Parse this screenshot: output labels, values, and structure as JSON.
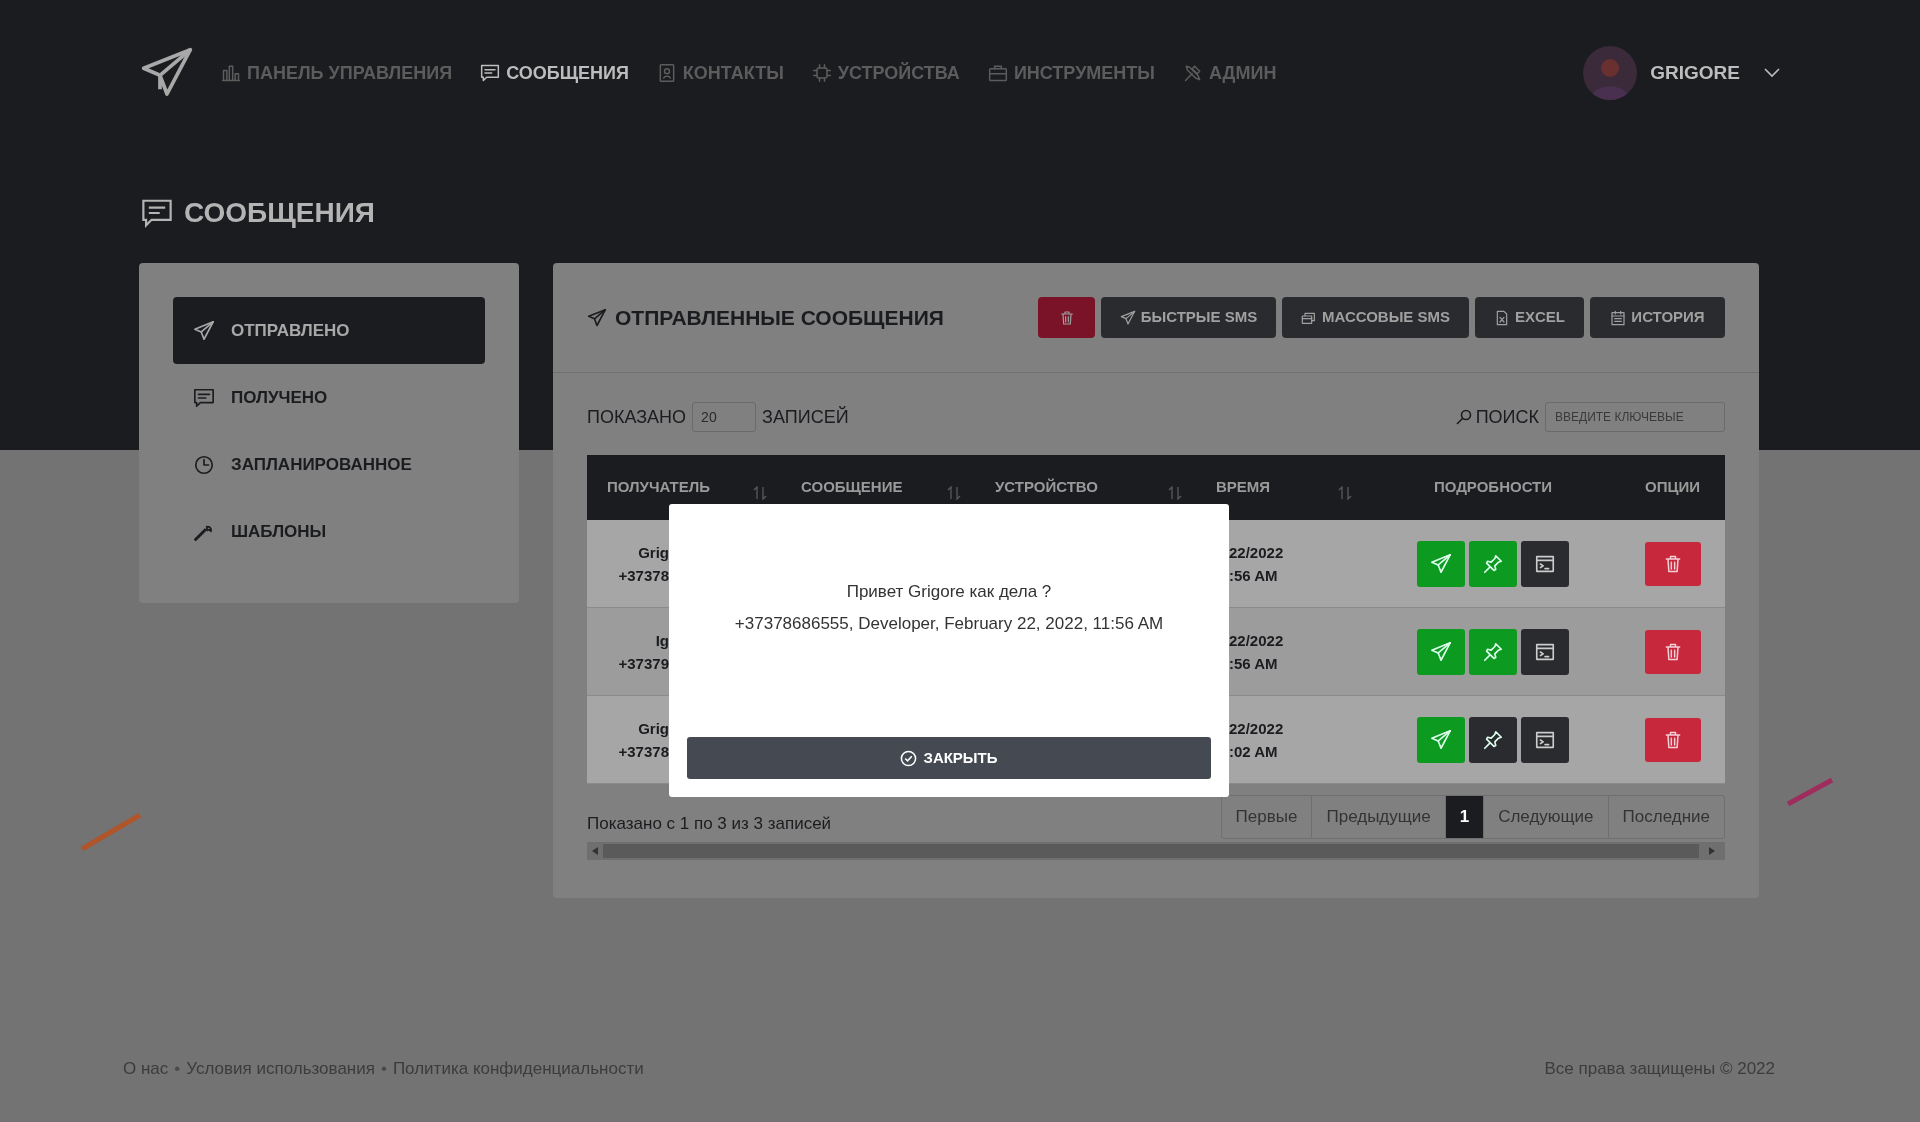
{
  "nav": {
    "items": [
      {
        "label": "ПАНЕЛЬ УПРАВЛЕНИЯ",
        "selected": false
      },
      {
        "label": "СООБЩЕНИЯ",
        "selected": true
      },
      {
        "label": "КОНТАКТЫ",
        "selected": false
      },
      {
        "label": "УСТРОЙСТВА",
        "selected": false
      },
      {
        "label": "ИНСТРУМЕНТЫ",
        "selected": false
      },
      {
        "label": "АДМИН",
        "selected": false
      }
    ],
    "user": {
      "name": "GRIGORE"
    }
  },
  "page_title": "СООБЩЕНИЯ",
  "sidebar": {
    "items": [
      {
        "label": "ОТПРАВЛЕНО",
        "selected": true
      },
      {
        "label": "ПОЛУЧЕНО",
        "selected": false
      },
      {
        "label": "ЗАПЛАНИРОВАННОЕ",
        "selected": false
      },
      {
        "label": "ШАБЛОНЫ",
        "selected": false
      }
    ]
  },
  "panel": {
    "title": "ОТПРАВЛЕННЫЕ СООБЩЕНИЯ",
    "buttons": [
      {
        "kind": "danger"
      },
      {
        "kind": "dark",
        "label": "БЫСТРЫЕ SMS"
      },
      {
        "kind": "dark",
        "label": "МАССОВЫЕ SMS"
      },
      {
        "kind": "dark",
        "label": "EXCEL"
      },
      {
        "kind": "dark",
        "label": "ИСТОРИЯ"
      }
    ]
  },
  "length_control": {
    "before": "ПОКАЗАНО",
    "value": "20",
    "after": "ЗАПИСЕЙ"
  },
  "search": {
    "label": "ПОИСК",
    "placeholder": "ВВЕДИТЕ КЛЮЧЕВЫЕ"
  },
  "table": {
    "columns": [
      {
        "label": "ПОЛУЧАТЕЛЬ",
        "sortable": true
      },
      {
        "label": "СООБЩЕНИЕ",
        "sortable": true
      },
      {
        "label": "УСТРОЙСТВО",
        "sortable": true
      },
      {
        "label": "ВРЕМЯ",
        "sortable": true
      },
      {
        "label": "ПОДРОБНОСТИ",
        "sortable": false
      },
      {
        "label": "ОПЦИИ",
        "sortable": false
      }
    ],
    "rows": [
      {
        "recipient": [
          "Grig",
          "+37378"
        ],
        "time": [
          "22/2022",
          ":56 AM"
        ],
        "pinned": true
      },
      {
        "recipient": [
          "Ig",
          "+37379"
        ],
        "time": [
          "22/2022",
          ":56 AM"
        ],
        "pinned": true
      },
      {
        "recipient": [
          "Grig",
          "+37378"
        ],
        "time": [
          "22/2022",
          ":02 AM"
        ],
        "pinned": false
      }
    ]
  },
  "info": "Показано с 1 по 3 из 3 записей",
  "pagination": [
    {
      "label": "Первые",
      "selected": false
    },
    {
      "label": "Предыдущие",
      "selected": false
    },
    {
      "label": "1",
      "selected": true
    },
    {
      "label": "Следующие",
      "selected": false
    },
    {
      "label": "Последние",
      "selected": false
    }
  ],
  "footer": {
    "links": [
      {
        "kind": "link",
        "text": "О нас"
      },
      {
        "kind": "separator",
        "text": "•"
      },
      {
        "kind": "link",
        "text": "Условия использования"
      },
      {
        "kind": "separator",
        "text": "•"
      },
      {
        "kind": "link",
        "text": "Политика конфиденциальности"
      }
    ],
    "copyright": "Все права защищены © 2022"
  },
  "modal": {
    "message": "Привет Grigore как дела ?",
    "details": "+37378686555, Developer, February 22, 2022, 11:56 AM",
    "button": "ЗАКРЫТЬ"
  }
}
